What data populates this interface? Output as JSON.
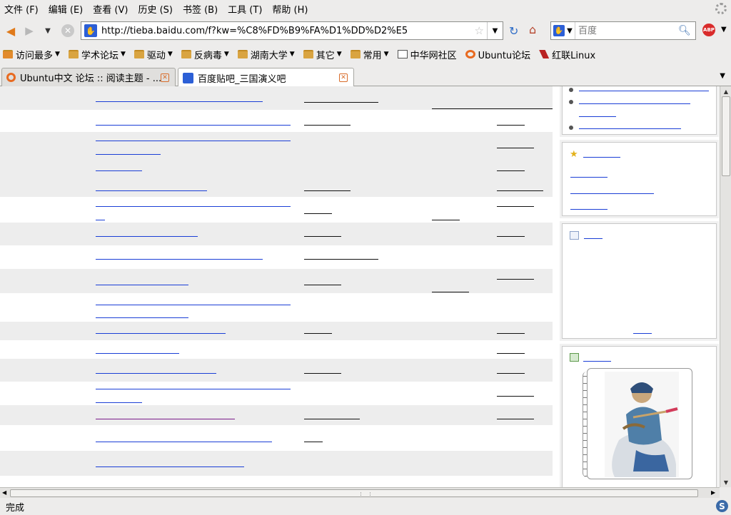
{
  "menubar": {
    "items": [
      "文件 (F)",
      "编辑 (E)",
      "查看 (V)",
      "历史 (S)",
      "书签 (B)",
      "工具 (T)",
      "帮助 (H)"
    ]
  },
  "navbar": {
    "url": "http://tieba.baidu.com/f?kw=%C8%FD%B9%FA%D1%DD%D2%E5",
    "search_placeholder": "百度"
  },
  "bookmarks": [
    {
      "label": "访问最多",
      "icon": "rss-icon",
      "dropdown": true
    },
    {
      "label": "学术论坛",
      "icon": "folder-icon",
      "dropdown": true
    },
    {
      "label": "驱动",
      "icon": "folder-icon",
      "dropdown": true
    },
    {
      "label": "反病毒",
      "icon": "folder-icon",
      "dropdown": true
    },
    {
      "label": "湖南大学",
      "icon": "folder-icon",
      "dropdown": true
    },
    {
      "label": "其它",
      "icon": "folder-icon",
      "dropdown": true
    },
    {
      "label": "常用",
      "icon": "folder-icon",
      "dropdown": true
    },
    {
      "label": "中华网社区",
      "icon": "page-icon",
      "dropdown": false
    },
    {
      "label": "Ubuntu论坛",
      "icon": "ubuntu-icon",
      "dropdown": false
    },
    {
      "label": "红联Linux",
      "icon": "redflag-icon",
      "dropdown": false
    }
  ],
  "tabs": [
    {
      "label": "Ubuntu中文 论坛 :: 阅读主题 - ...",
      "active": false
    },
    {
      "label": "百度贴吧_三国演义吧",
      "active": true
    }
  ],
  "status": {
    "text": "完成"
  },
  "colors": {
    "link": "#1a3ed6",
    "visited_link": "#7a1a8a",
    "row_alt": "#ededed",
    "chrome_bg": "#edeceb"
  }
}
